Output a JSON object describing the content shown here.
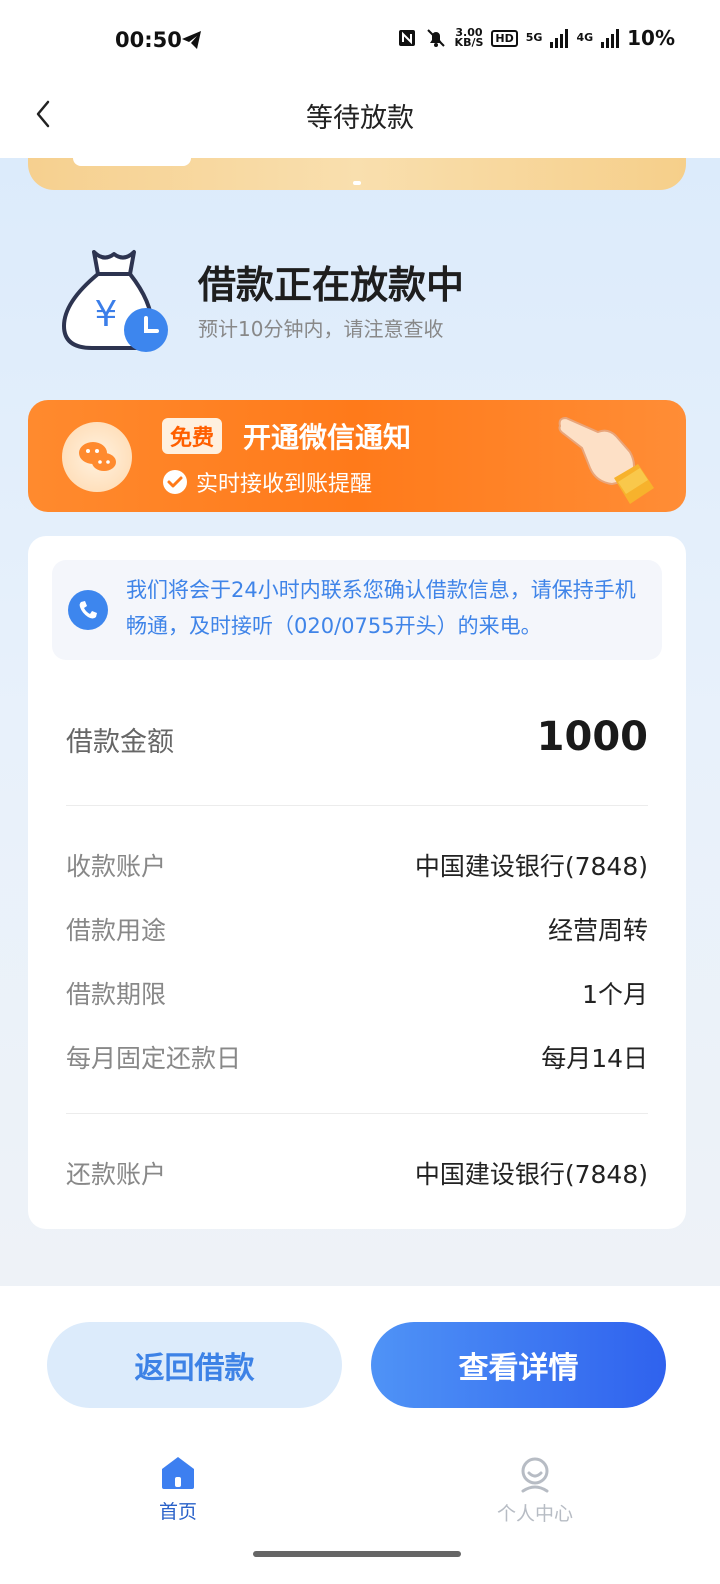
{
  "status_bar": {
    "time": "00:50",
    "net_speed": "3.00",
    "net_unit": "KB/S",
    "hd": "HD",
    "net1": "5G",
    "net2": "4G",
    "battery": "10%"
  },
  "nav": {
    "title": "等待放款"
  },
  "loan_status": {
    "title": "借款正在放款中",
    "subtitle": "预计10分钟内，请注意查收"
  },
  "wechat": {
    "tag": "免费",
    "title": "开通微信通知",
    "subtitle": "实时接收到账提醒"
  },
  "notice": {
    "text": "我们将会于24小时内联系您确认借款信息，请保持手机畅通，及时接听（020/0755开头）的来电。"
  },
  "details": {
    "amount_label": "借款金额",
    "amount_value": "1000",
    "rows": [
      {
        "label": "收款账户",
        "value": "中国建设银行(7848)"
      },
      {
        "label": "借款用途",
        "value": "经营周转"
      },
      {
        "label": "借款期限",
        "value": "1个月"
      },
      {
        "label": "每月固定还款日",
        "value": "每月14日"
      }
    ],
    "repay_label": "还款账户",
    "repay_value": "中国建设银行(7848)"
  },
  "buttons": {
    "return": "返回借款",
    "detail": "查看详情"
  },
  "tabbar": {
    "home": "首页",
    "me": "个人中心"
  },
  "colors": {
    "accent": "#2f62ee",
    "orange": "#ff7a1a",
    "notice_text": "#3f84e8"
  }
}
